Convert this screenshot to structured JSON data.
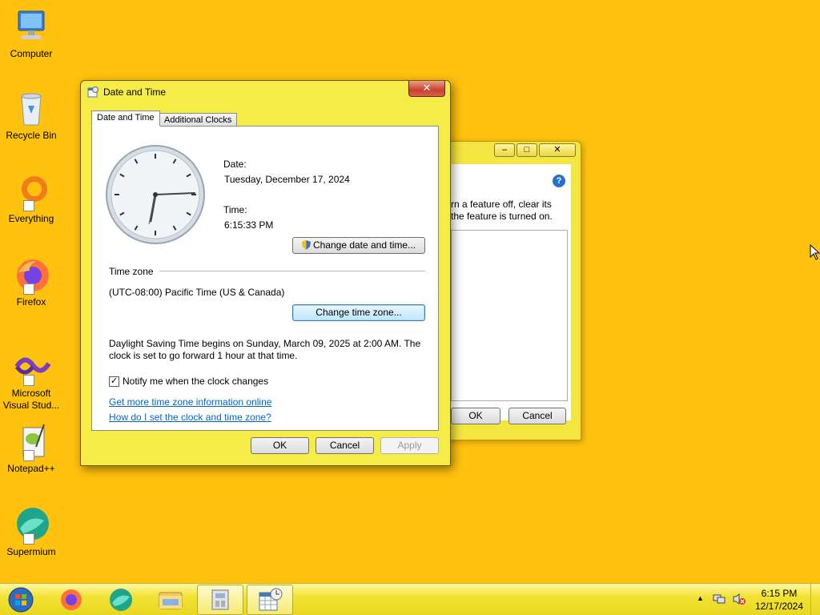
{
  "desktop": {
    "icons": [
      {
        "label": "Computer",
        "icon": "computer-icon"
      },
      {
        "label": "Recycle Bin",
        "icon": "recycle-bin-icon"
      },
      {
        "label": "Everything",
        "icon": "everything-icon"
      },
      {
        "label": "Firefox",
        "icon": "firefox-icon"
      },
      {
        "label": "Microsoft Visual Stud...",
        "icon": "visual-studio-icon"
      },
      {
        "label": "Notepad++",
        "icon": "notepadpp-icon"
      },
      {
        "label": "Supermium",
        "icon": "supermium-icon"
      }
    ]
  },
  "bg_window": {
    "help_text_line1": "rn a feature off, clear its",
    "help_text_line2": "the feature is turned on.",
    "ok_label": "OK",
    "cancel_label": "Cancel"
  },
  "dialog": {
    "title": "Date and Time",
    "close_label": "✕",
    "tabs": [
      {
        "label": "Date and Time",
        "active": true
      },
      {
        "label": "Additional Clocks",
        "active": false
      }
    ],
    "date_label": "Date:",
    "date_value": "Tuesday, December 17, 2024",
    "time_label": "Time:",
    "time_value": "6:15:33 PM",
    "change_datetime_button": "Change date and time...",
    "timezone_heading": "Time zone",
    "timezone_value": "(UTC-08:00) Pacific Time (US & Canada)",
    "change_timezone_button": "Change time zone...",
    "dst_line1": "Daylight Saving Time begins on Sunday, March 09, 2025 at 2:00 AM. The",
    "dst_line2": "clock is set to go forward 1 hour at that time.",
    "notify_checkbox_label": "Notify me when the clock changes",
    "notify_checked": true,
    "link_more_info": "Get more time zone information online",
    "link_how_set": "How do I set the clock and time zone?",
    "ok_label": "OK",
    "cancel_label": "Cancel",
    "apply_label": "Apply"
  },
  "taskbar": {
    "items": [
      "start-orb-icon",
      "firefox-icon",
      "supermium-icon",
      "explorer-icon",
      "control-panel-icon",
      "date-time-icon"
    ],
    "clock_time": "6:15 PM",
    "clock_date": "12/17/2024",
    "tray_icons": [
      "show-hidden-icons-icon",
      "network-icon",
      "volume-muted-icon"
    ]
  },
  "colors": {
    "desktop_bg": "#FFC20E",
    "window_frame": "#F6EC48",
    "link": "#0066cc"
  }
}
